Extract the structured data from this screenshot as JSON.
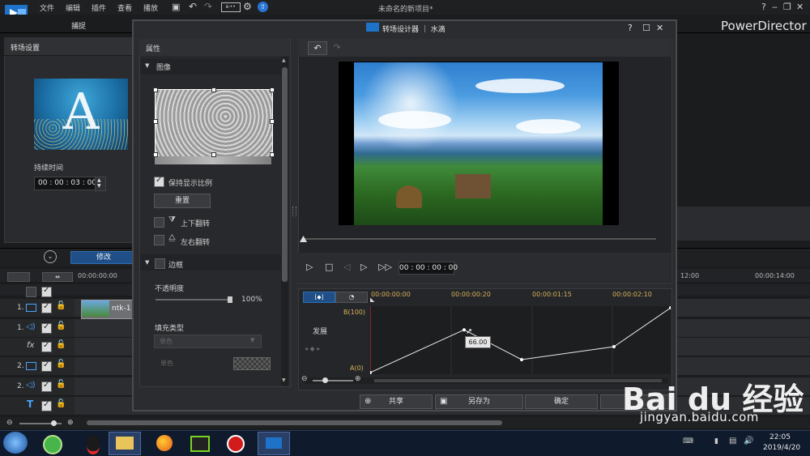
{
  "menubar": {
    "items": [
      "文件",
      "编辑",
      "插件",
      "查看",
      "播放"
    ],
    "timecode_mode": "ℹ‹••",
    "title": "未命名的新项目*",
    "help": "?",
    "brand": "PowerDirector"
  },
  "tabs": {
    "capture": "捕捉"
  },
  "left_panel": {
    "title": "转场设置",
    "thumb_letter": "A",
    "duration_label": "持续时间",
    "duration_value": "00 : 00 : 03 : 00"
  },
  "timeline": {
    "modify_label": "修改",
    "ruler_start": "00:00:00:00",
    "ruler_right1": "12:00",
    "ruler_right2": "00:00:14:00",
    "tracks": [
      "1.",
      "1.",
      "fx",
      "2.",
      "2.",
      "T"
    ],
    "clip_label": "ntk-1"
  },
  "dialog": {
    "title": "转场设计器 ｜ 水滴",
    "help": "?",
    "properties_label": "属性",
    "image_section": "图像",
    "keep_ratio_label": "保持显示比例",
    "reset_label": "重置",
    "flip_vertical_label": "上下翻转",
    "flip_horizontal_label": "左右翻转",
    "border_section": "边框",
    "opacity_label": "不透明度",
    "opacity_value": "100%",
    "fill_type_label": "填充类型",
    "fill_type_value": "单色",
    "color_label": "单色",
    "timecode": "00 : 00 : 00 : 00",
    "graph": {
      "times": [
        "00:00:00:00",
        "00:00:00:20",
        "00:00:01:15",
        "00:00:02:10"
      ],
      "top_label": "B(100)",
      "bottom_label": "A(0)",
      "track_label": "发展",
      "tooltip_value": "66.00",
      "points": [
        0,
        66,
        20,
        40,
        100
      ]
    },
    "buttons": {
      "share": "共享",
      "save_as": "另存为",
      "ok": "确定"
    }
  },
  "taskbar": {
    "time": "22:05",
    "date": "2019/4/20"
  },
  "watermark": {
    "logo": "Bai du 经验",
    "url": "jingyan.baidu.com"
  }
}
